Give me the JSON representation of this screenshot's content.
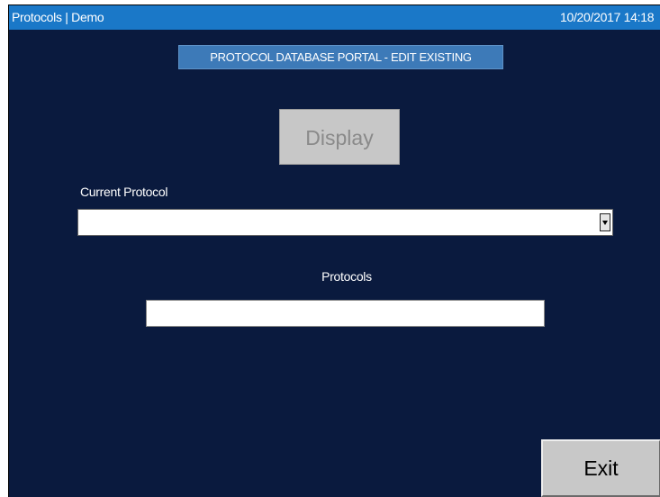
{
  "window": {
    "title": "Protocols | Demo",
    "datetime": "10/20/2017 14:18"
  },
  "banner": {
    "text": "PROTOCOL DATABASE PORTAL - EDIT EXISTING"
  },
  "display_button": {
    "label": "Display",
    "enabled": false
  },
  "current_protocol": {
    "label": "Current Protocol",
    "value": ""
  },
  "protocols": {
    "label": "Protocols",
    "value": ""
  },
  "exit_button": {
    "label": "Exit"
  },
  "colors": {
    "background": "#0a1a3e",
    "titlebar": "#1a78c8",
    "banner": "#3d7ab8",
    "button_disabled": "#c7c7c7",
    "button": "#c8c8c8"
  },
  "icons": {
    "dropdown": "chevron-down-icon"
  }
}
